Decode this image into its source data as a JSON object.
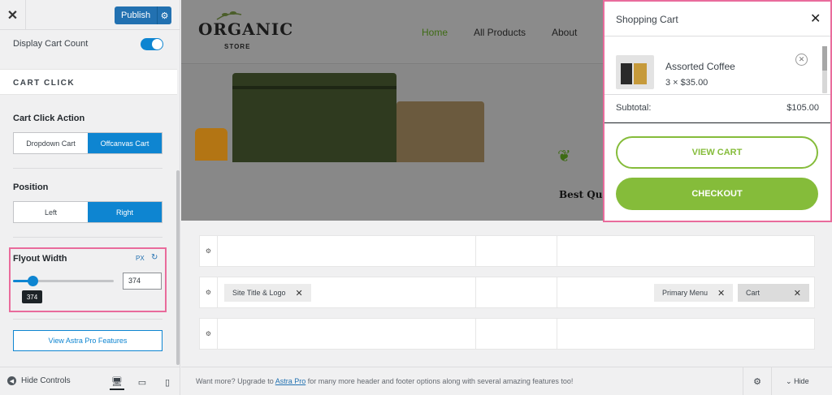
{
  "panel": {
    "close_label": "✕",
    "publish_label": "Publish",
    "display_cart_count": "Display Cart Count",
    "toggle_state": "on",
    "section_cart_click": "CART CLICK",
    "cart_click_action": {
      "label": "Cart Click Action",
      "options": [
        "Dropdown Cart",
        "Offcanvas Cart"
      ],
      "selected": "Offcanvas Cart"
    },
    "position": {
      "label": "Position",
      "options": [
        "Left",
        "Right"
      ],
      "selected": "Right"
    },
    "flyout_width": {
      "label": "Flyout Width",
      "unit": "PX",
      "value": "374",
      "tooltip": "374"
    },
    "astra_pro_button": "View Astra Pro Features"
  },
  "footer": {
    "hide_controls": "Hide Controls",
    "upsell_prefix": "Want more? Upgrade to ",
    "upsell_link": "Astra Pro",
    "upsell_suffix": " for many more header and footer options along with several amazing features too!",
    "hide_label": "Hide"
  },
  "preview": {
    "logo_text": "ORGANIC",
    "logo_sub": "STORE",
    "nav": [
      "Home",
      "All Products",
      "About"
    ],
    "hero_heading": "Best Qua"
  },
  "cart": {
    "title": "Shopping Cart",
    "item": {
      "name": "Assorted Coffee",
      "qty_price": "3 × $35.00"
    },
    "subtotal_label": "Subtotal:",
    "subtotal_value": "$105.00",
    "view_cart": "VIEW CART",
    "checkout": "CHECKOUT"
  },
  "builder": {
    "chips": {
      "site_title": "Site Title & Logo",
      "primary_menu": "Primary Menu",
      "cart": "Cart"
    }
  },
  "colors": {
    "accent_blue": "#0e85d1",
    "highlight_pink": "#e96b9c",
    "cart_green": "#85bc3a"
  }
}
